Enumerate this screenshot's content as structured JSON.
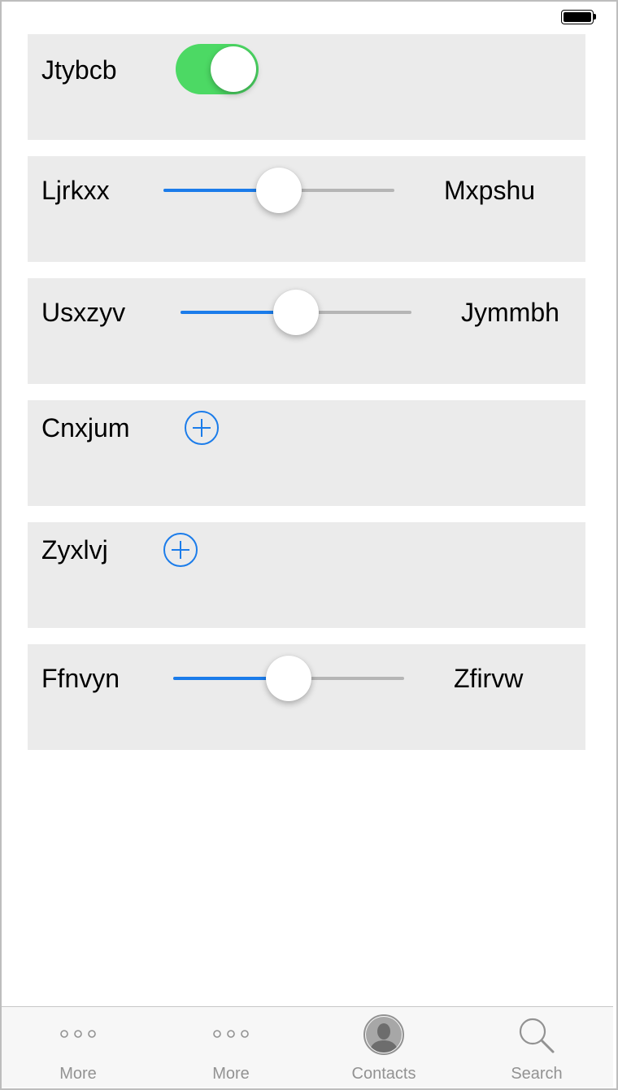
{
  "status_bar": {
    "battery_icon": "battery-full-icon"
  },
  "rows": [
    {
      "type": "toggle",
      "label": "Jtybcb",
      "on": true,
      "on_color": "#4cd964"
    },
    {
      "type": "slider",
      "label": "Ljrkxx",
      "right_label": "Mxpshu",
      "value": 0.5
    },
    {
      "type": "slider",
      "label": "Usxzyv",
      "right_label": "Jymmbh",
      "value": 0.5
    },
    {
      "type": "add",
      "label": "Cnxjum",
      "icon": "plus-circle-icon"
    },
    {
      "type": "add",
      "label": "Zyxlvj",
      "icon": "plus-circle-icon"
    },
    {
      "type": "slider",
      "label": "Ffnvyn",
      "right_label": "Zfirvw",
      "value": 0.5
    }
  ],
  "tabbar": {
    "tabs": [
      {
        "label": "More",
        "icon": "more-icon"
      },
      {
        "label": "More",
        "icon": "more-icon"
      },
      {
        "label": "Contacts",
        "icon": "contacts-icon"
      },
      {
        "label": "Search",
        "icon": "search-icon"
      }
    ]
  },
  "colors": {
    "accent": "#1b7cea",
    "toggle_on": "#4cd964",
    "row_background": "#ebebeb",
    "tab_inactive": "#929292"
  }
}
